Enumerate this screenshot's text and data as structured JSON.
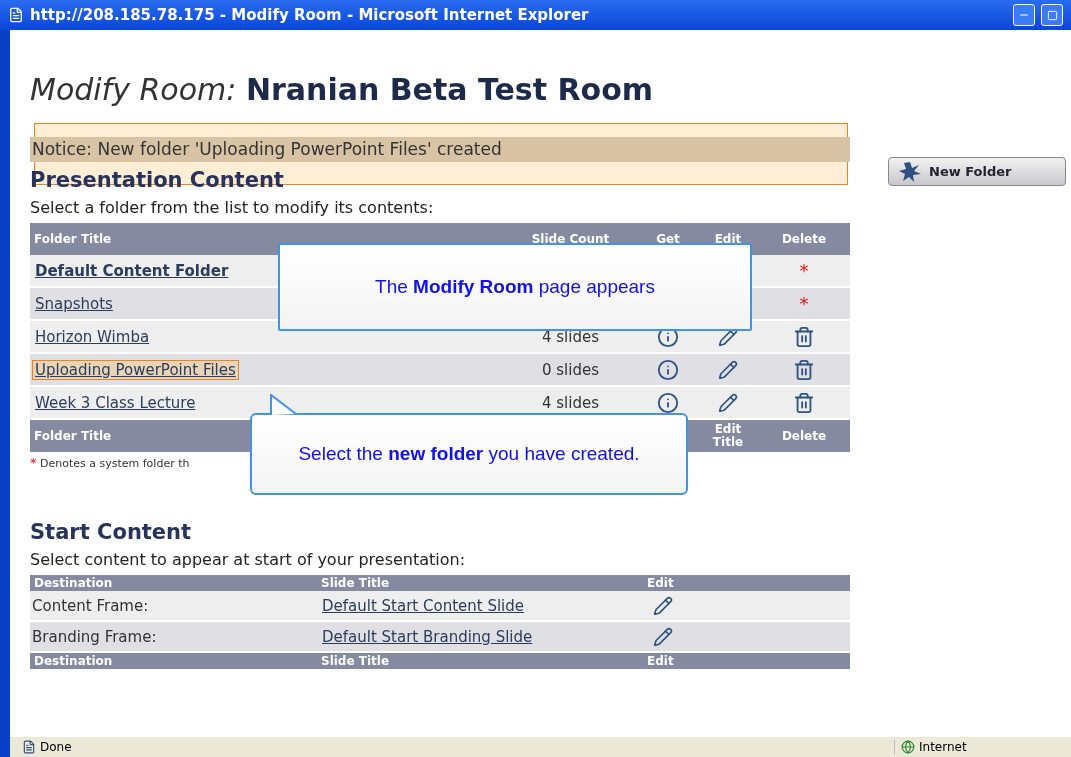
{
  "window": {
    "title": "http://208.185.78.175 - Modify Room - Microsoft Internet Explorer"
  },
  "page": {
    "title_prefix": "Modify Room:",
    "title": "Nranian Beta Test Room"
  },
  "notice": "Notice: New folder 'Uploading PowerPoint Files' created",
  "new_folder_button": "New Folder",
  "presentation": {
    "heading": "Presentation Content",
    "instruction": "Select a folder from the list to modify its contents:",
    "columns": [
      "Folder Title",
      "Slide Count",
      "Get",
      "Edit",
      "Delete"
    ],
    "footer_columns": [
      "Folder Title",
      "Edit Title",
      "Delete"
    ],
    "rows": [
      {
        "title": "Default Content Folder",
        "kind": "system",
        "current": true,
        "highlighted": false
      },
      {
        "title": "Snapshots",
        "kind": "system",
        "current": false,
        "highlighted": false
      },
      {
        "title": "Horizon  Wimba",
        "kind": "user",
        "slides": "4 slides",
        "current": false,
        "highlighted": false
      },
      {
        "title": "Uploading PowerPoint Files",
        "kind": "user",
        "slides": "0 slides",
        "current": false,
        "highlighted": true
      },
      {
        "title": "Week 3 Class Lecture",
        "kind": "user",
        "slides": "4 slides",
        "current": false,
        "highlighted": false
      }
    ],
    "system_mark": "*",
    "footnote": "Denotes a system folder th"
  },
  "start": {
    "heading": "Start Content",
    "instruction": "Select content to appear at start of your presentation:",
    "columns": [
      "Destination",
      "Slide Title",
      "Edit"
    ],
    "rows": [
      {
        "destination": "Content Frame:",
        "slide": "Default Start Content Slide"
      },
      {
        "destination": "Branding Frame:",
        "slide": "Default Start Branding Slide"
      }
    ],
    "footer_columns": [
      "Destination",
      "Slide Title",
      "Edit"
    ]
  },
  "callouts": [
    {
      "text": "The **Modify Room** page appears",
      "pointer": false
    },
    {
      "text": "Select the **new folder** you have created.",
      "pointer": true
    }
  ],
  "status_bar": {
    "status": "Done",
    "zone": "Internet"
  }
}
